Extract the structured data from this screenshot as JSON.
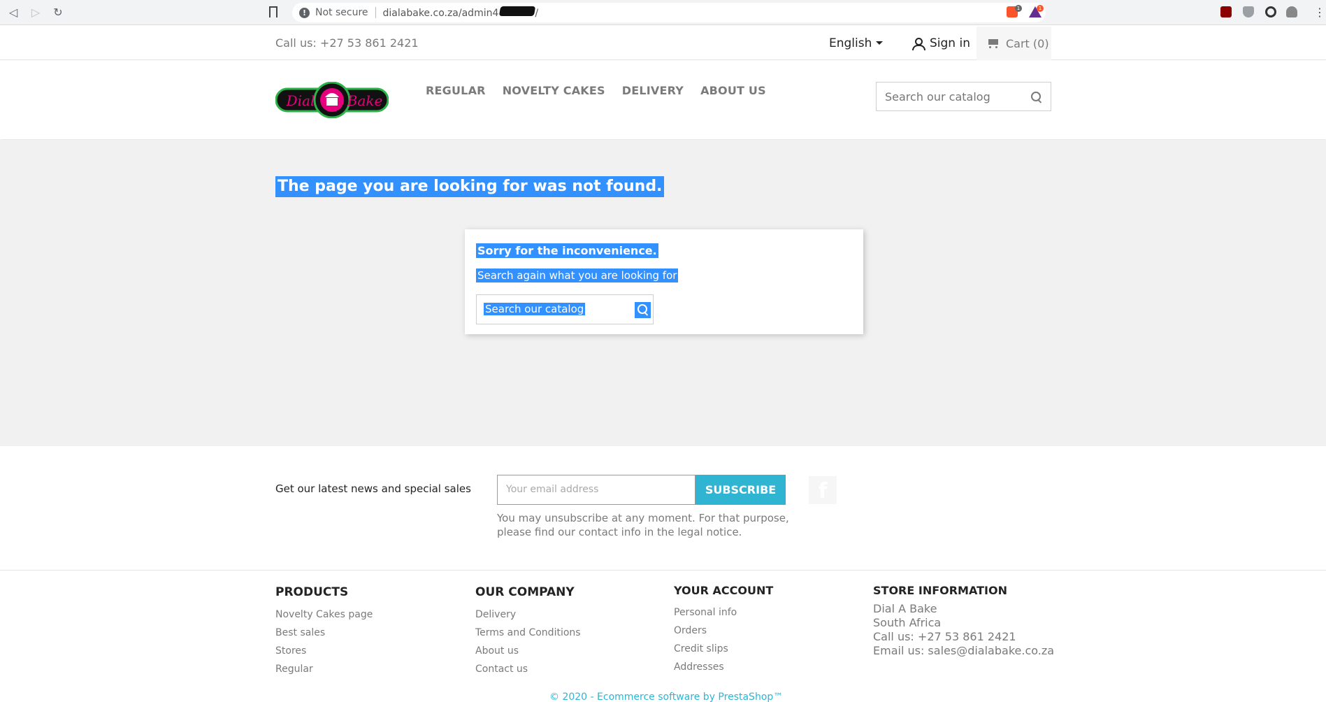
{
  "browser": {
    "back": "◁",
    "forward": "▷",
    "reload": "↻",
    "not_secure": "Not secure",
    "url": "dialabake.co.za/admin4",
    "url_suffix": "/",
    "brave_badge": "1",
    "bat_badge": "1",
    "menu": "⋮"
  },
  "topbar": {
    "call_us": "Call us: +27 53 861 2421",
    "language": "English",
    "sign_in": "Sign in",
    "cart": "Cart (0)"
  },
  "header": {
    "logo_text_left": "Dial",
    "logo_text_right": "Bake",
    "nav": [
      "REGULAR",
      "NOVELTY CAKES",
      "DELIVERY",
      "ABOUT US"
    ],
    "search_placeholder": "Search our catalog"
  },
  "main": {
    "title": "The page you are looking for was not found.",
    "sorry": "Sorry for the inconvenience.",
    "search_again": "Search again what you are looking for",
    "search_placeholder": "Search our catalog"
  },
  "newsletter": {
    "label": "Get our latest news and special sales",
    "email_placeholder": "Your email address",
    "subscribe": "SUBSCRIBE",
    "note": "You may unsubscribe at any moment. For that purpose, please find our contact info in the legal notice.",
    "facebook": "f"
  },
  "footer": {
    "products": {
      "title": "PRODUCTS",
      "links": [
        "Novelty Cakes page",
        "Best sales",
        "Stores",
        "Regular"
      ]
    },
    "company": {
      "title": "OUR COMPANY",
      "links": [
        "Delivery",
        "Terms and Conditions",
        "About us",
        "Contact us"
      ]
    },
    "account": {
      "title": "YOUR ACCOUNT",
      "links": [
        "Personal info",
        "Orders",
        "Credit slips",
        "Addresses"
      ]
    },
    "store": {
      "title": "STORE INFORMATION",
      "lines": [
        "Dial A Bake",
        "South Africa",
        "Call us: +27 53 861 2421",
        "Email us: sales@dialabake.co.za"
      ]
    },
    "copyright": "© 2020 - Ecommerce software by PrestaShop™"
  },
  "colors": {
    "accent": "#2fb5d2",
    "selection": "#3390ff",
    "content_bg": "#f1f1f1",
    "logo_green": "#2db34a",
    "logo_pink": "#e6007e"
  }
}
